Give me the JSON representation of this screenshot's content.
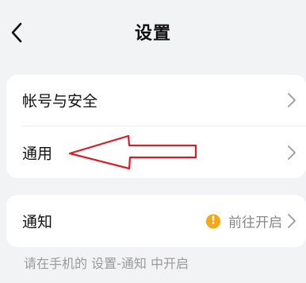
{
  "header": {
    "title": "设置"
  },
  "card1": {
    "items": [
      {
        "label": "帐号与安全"
      },
      {
        "label": "通用"
      }
    ]
  },
  "card2": {
    "notify": {
      "label": "通知",
      "status_text": "前往开启",
      "status_icon_text": "!"
    }
  },
  "footnote": "请在手机的 设置-通知 中开启",
  "colors": {
    "background": "#f2f3f5",
    "card": "#ffffff",
    "warning": "#f2a81a",
    "annotation_arrow": "#d61f26"
  },
  "icons": {
    "back": "chevron-left-icon",
    "row_chevron": "chevron-right-icon",
    "warning": "warning-icon"
  }
}
